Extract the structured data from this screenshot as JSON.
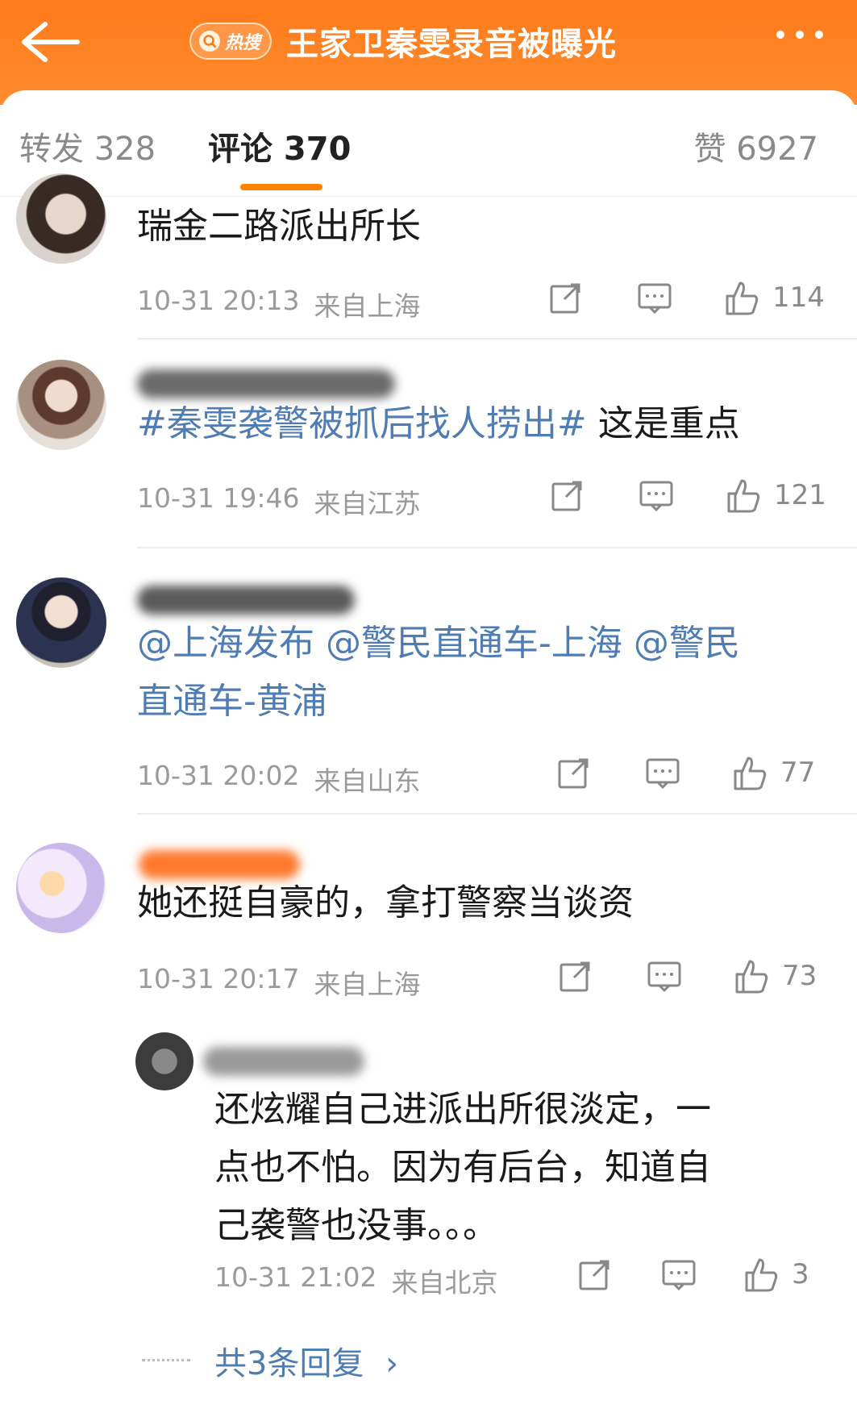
{
  "header": {
    "hot_badge": "热搜",
    "title": "王家卫秦雯录音被曝光"
  },
  "tabs": {
    "repost": "转发 328",
    "comments": "评论 370",
    "likes": "赞 6927"
  },
  "comments": [
    {
      "text": "瑞金二路派出所长",
      "time": "10-31 20:13",
      "location": "来自上海",
      "likes": "114"
    },
    {
      "hashtag": "#秦雯袭警被抓后找人捞出#",
      "text": " 这是重点",
      "time": "10-31 19:46",
      "location": "来自江苏",
      "likes": "121"
    },
    {
      "line1": "@上海发布 @警民直通车-上海 @警民",
      "line2": "直通车-黄浦",
      "time": "10-31 20:02",
      "location": "来自山东",
      "likes": "77"
    },
    {
      "text": "她还挺自豪的，拿打警察当谈资",
      "time": "10-31 20:17",
      "location": "来自上海",
      "likes": "73"
    }
  ],
  "reply": {
    "line1": "还炫耀自己进派出所很淡定，一",
    "line2": "点也不怕。因为有后台，知道自",
    "line3": "己袭警也没事。。。",
    "time": "10-31 21:02",
    "location": "来自北京",
    "likes": "3",
    "more_label": "共3条回复",
    "more_arrow": "›"
  },
  "colors": {
    "header_orange": "#ff7a1a",
    "tab_indicator": "#ff8200",
    "link_blue": "#4f7cb3"
  }
}
